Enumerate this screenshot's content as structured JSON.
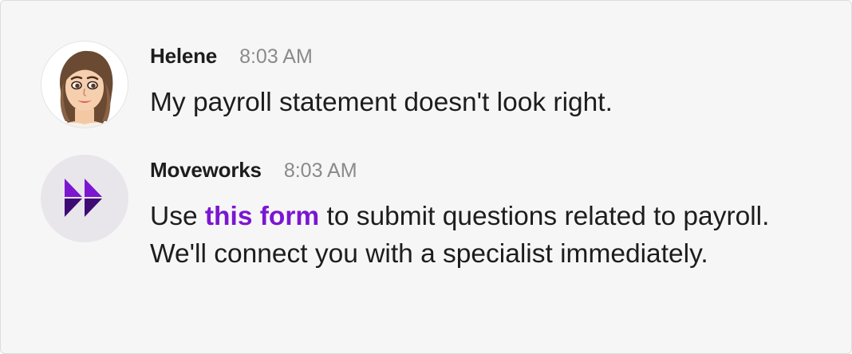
{
  "messages": [
    {
      "sender": "Helene",
      "time": "8:03 AM",
      "avatar": "helene-avatar",
      "text": "My payroll statement doesn't look right."
    },
    {
      "sender": "Moveworks",
      "time": "8:03 AM",
      "avatar": "moveworks-logo-icon",
      "text_before": "Use ",
      "link_text": "this form",
      "text_after": " to submit questions related to payroll. We'll connect you with a specialist immediately."
    }
  ],
  "colors": {
    "link": "#7b16d1",
    "logo_light": "#7b16d1",
    "logo_dark": "#3e0a73",
    "background": "#f7f6f7"
  }
}
